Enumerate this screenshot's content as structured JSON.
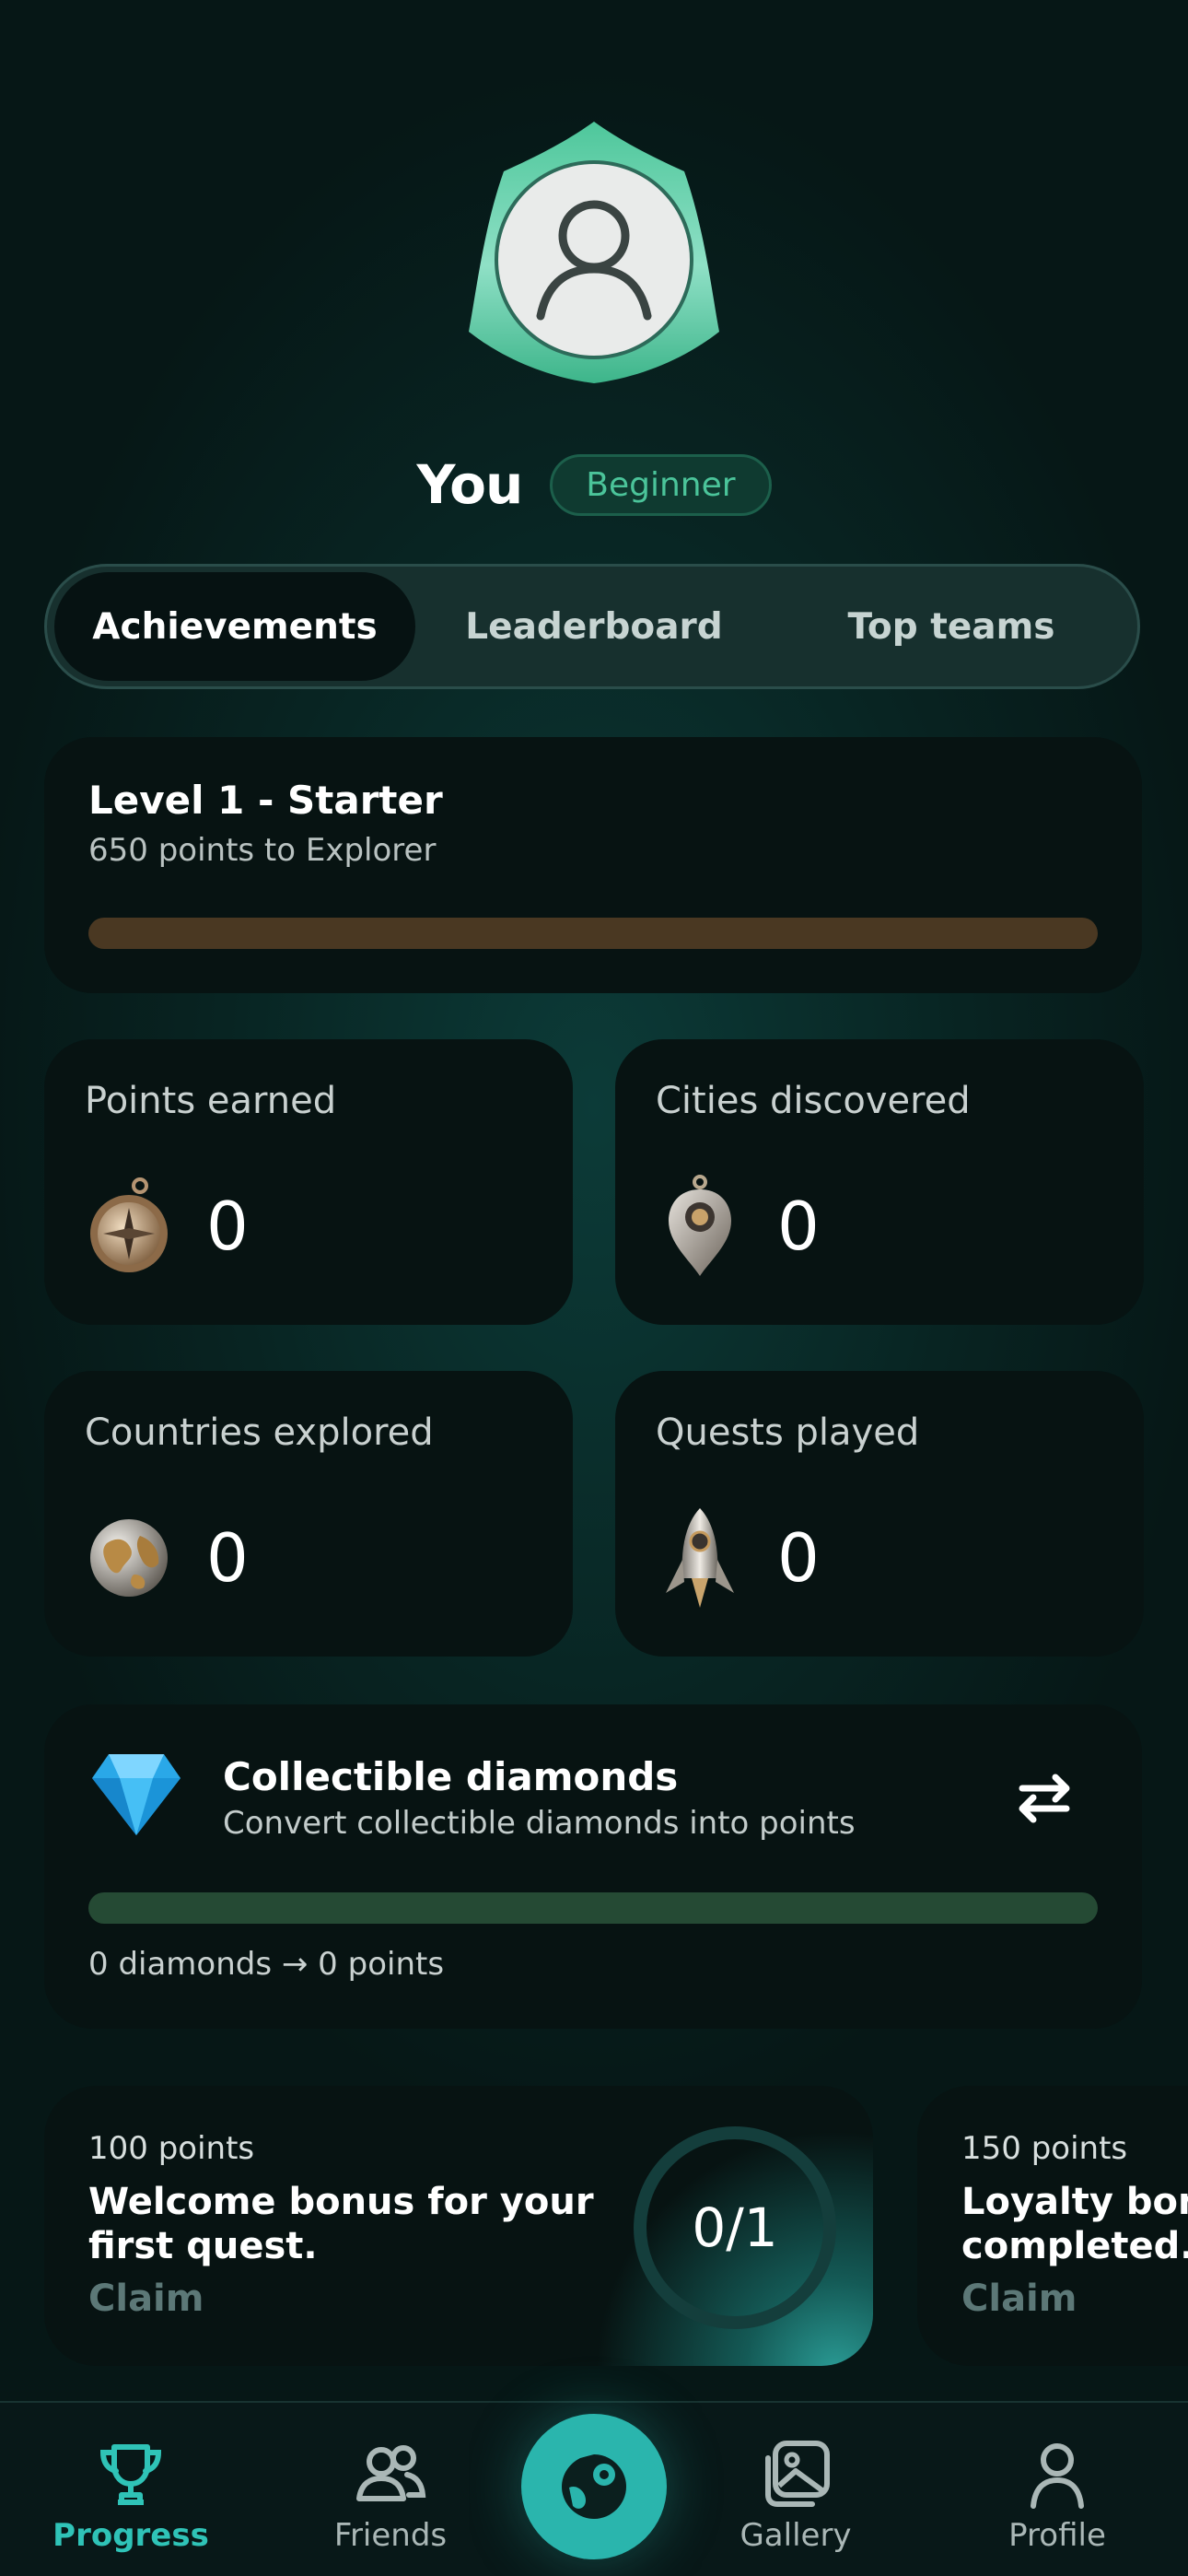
{
  "profile": {
    "name": "You",
    "rank": "Beginner"
  },
  "tabs": [
    {
      "label": "Achievements",
      "active": true
    },
    {
      "label": "Leaderboard",
      "active": false
    },
    {
      "label": "Top teams",
      "active": false
    }
  ],
  "level": {
    "title": "Level 1 - Starter",
    "subtitle": "650 points to Explorer",
    "progress": 0
  },
  "stats": [
    {
      "label": "Points earned",
      "value": "0",
      "icon": "compass-icon"
    },
    {
      "label": "Cities discovered",
      "value": "0",
      "icon": "location-pin-icon"
    },
    {
      "label": "Countries explored",
      "value": "0",
      "icon": "globe-icon"
    },
    {
      "label": "Quests played",
      "value": "0",
      "icon": "rocket-icon"
    }
  ],
  "diamonds": {
    "title": "Collectible diamonds",
    "subtitle": "Convert collectible diamonds into points",
    "footer": "0 diamonds → 0 points",
    "progress": 0
  },
  "quests": [
    {
      "points": "100 points",
      "title": "Welcome bonus for your first quest.",
      "claim": "Claim",
      "progress": "0/1"
    },
    {
      "points": "150 points",
      "title": "Loyalty bonus completed.",
      "claim": "Claim"
    }
  ],
  "nav": {
    "items": [
      {
        "label": "Progress",
        "icon": "trophy-icon",
        "active": true
      },
      {
        "label": "Friends",
        "icon": "friends-icon",
        "active": false
      },
      {
        "label": "Gallery",
        "icon": "gallery-icon",
        "active": false
      },
      {
        "label": "Profile",
        "icon": "profile-icon",
        "active": false
      }
    ],
    "center_icon": "map-play-icon"
  },
  "colors": {
    "accent": "#2ab5ad",
    "rank_green": "#4bc49a",
    "level_bar": "#4a3822",
    "diamond_bar": "#254a34"
  }
}
